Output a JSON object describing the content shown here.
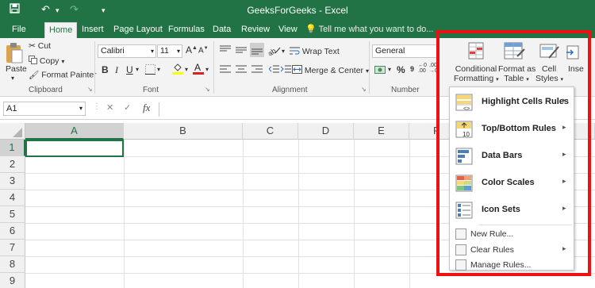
{
  "app": {
    "title": "GeeksForGeeks - Excel"
  },
  "tabs": [
    "File",
    "Home",
    "Insert",
    "Page Layout",
    "Formulas",
    "Data",
    "Review",
    "View"
  ],
  "tell_me": "Tell me what you want to do...",
  "clipboard": {
    "paste": "Paste",
    "cut": "Cut",
    "copy": "Copy",
    "format_painter": "Format Painter",
    "label": "Clipboard"
  },
  "font": {
    "name": "Calibri",
    "size": "11",
    "label": "Font"
  },
  "alignment": {
    "wrap": "Wrap Text",
    "merge": "Merge & Center",
    "label": "Alignment"
  },
  "number": {
    "format": "General",
    "label": "Number"
  },
  "styles": {
    "conditional_line1": "Conditional",
    "conditional_line2": "Formatting",
    "format_table_line1": "Format as",
    "format_table_line2": "Table",
    "cell_styles_line1": "Cell",
    "cell_styles_line2": "Styles",
    "insert": "Inse"
  },
  "formula_bar": {
    "name_box": "A1",
    "fx": "fx",
    "cancel": "✕",
    "enter": "✓"
  },
  "columns": [
    "A",
    "B",
    "C",
    "D",
    "E",
    "F"
  ],
  "rows": [
    "1",
    "2",
    "3",
    "4",
    "5",
    "6",
    "7",
    "8",
    "9"
  ],
  "menu": {
    "items": [
      "Highlight Cells Rules",
      "Top/Bottom Rules",
      "Data Bars",
      "Color Scales",
      "Icon Sets"
    ],
    "small": [
      "New Rule...",
      "Clear Rules",
      "Manage Rules..."
    ],
    "top_icon_text": "10"
  },
  "colors": {
    "excel_green": "#217346",
    "highlight_red": "#ee1111"
  }
}
